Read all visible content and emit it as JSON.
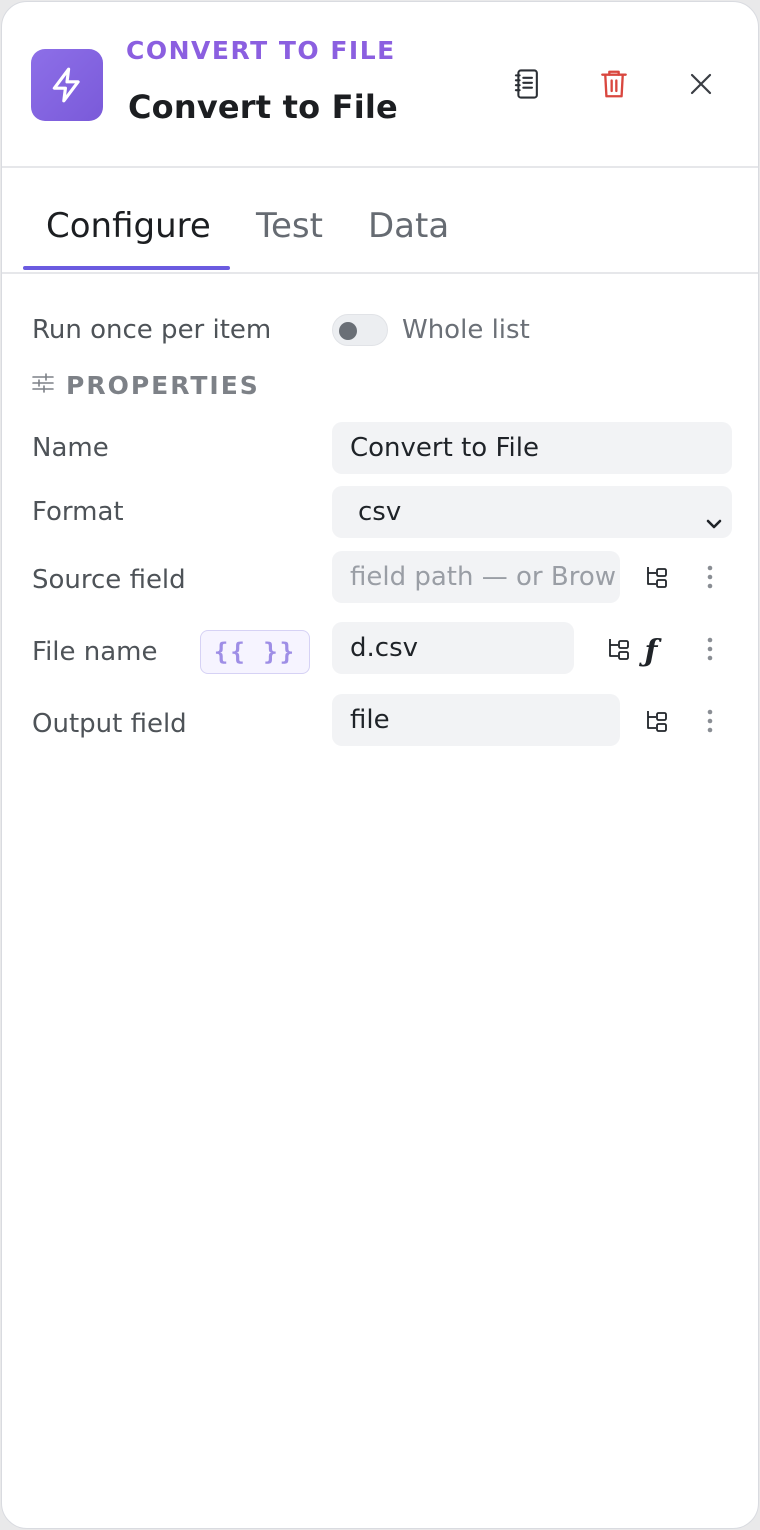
{
  "header": {
    "node_type": "CONVERT TO FILE",
    "title": "Convert to File",
    "icons": {
      "node": "lightning-icon",
      "docs": "notebook-icon",
      "delete": "trash-icon",
      "close": "close-icon"
    }
  },
  "tabs": [
    {
      "label": "Configure",
      "active": true
    },
    {
      "label": "Test",
      "active": false
    },
    {
      "label": "Data",
      "active": false
    }
  ],
  "run_mode": {
    "label": "Run once per item",
    "toggle_label": "Whole list",
    "enabled": false
  },
  "properties": {
    "section_title": "PROPERTIES",
    "section_icon": "sliders-icon",
    "name": {
      "label": "Name",
      "value": "Convert to File"
    },
    "format": {
      "label": "Format",
      "value": "csv"
    },
    "source_field": {
      "label": "Source field",
      "value": "",
      "placeholder": "field path — or Brow"
    },
    "file_name": {
      "label": "File name",
      "value": "d.csv",
      "expression_badge": "{{ }}"
    },
    "output_field": {
      "label": "Output field",
      "value": "file"
    }
  },
  "colors": {
    "accent": "#8b5fe0",
    "tab_underline": "#6b5be0",
    "delete": "#d9473f",
    "node_icon_bg": "#8d6fe8"
  }
}
